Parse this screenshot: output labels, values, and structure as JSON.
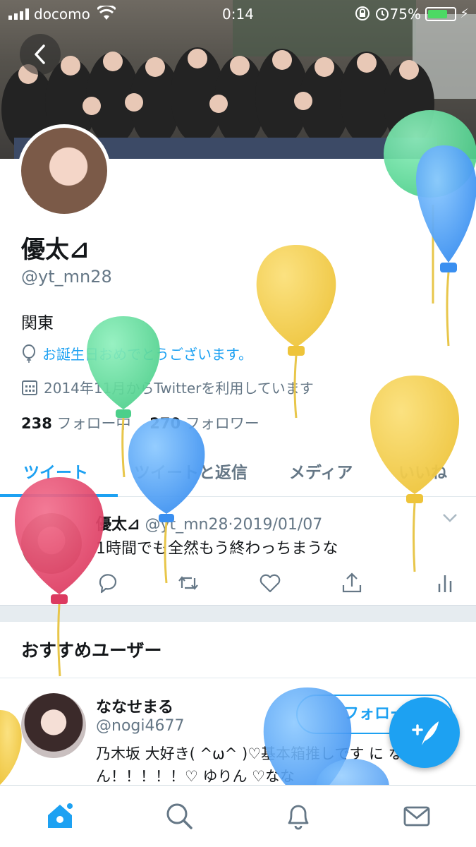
{
  "status_bar": {
    "carrier": "docomo",
    "time": "0:14",
    "battery": "75%",
    "battery_level": 0.75
  },
  "profile": {
    "name": "優太⊿",
    "handle": "@yt_mn28",
    "location": "関東",
    "birthday_text": "お誕生日おめでとうございます。",
    "joined_text": "2014年11月からTwitterを利用しています",
    "following_count": "238",
    "following_label": "フォロー中",
    "followers_count": "270",
    "followers_label": "フォロワー"
  },
  "tabs": [
    {
      "label": "ツイート",
      "active": true
    },
    {
      "label": "ツイートと返信",
      "active": false
    },
    {
      "label": "メディア",
      "active": false
    },
    {
      "label": "いいね",
      "active": false
    }
  ],
  "tweet": {
    "name": "優太⊿",
    "handle": "@yt_mn28",
    "separator": "·",
    "date": "2019/01/07",
    "text": "1時間でも全然もう終わっちまうな"
  },
  "recommended": {
    "title": "おすすめユーザー",
    "user": {
      "name": "ななせまる",
      "handle": "@nogi4677",
      "bio": "乃木坂 大好き( ^ω^ )♡基本箱推しです に なーちゃん！！！！！♡ ゆりん ♡なな",
      "follow_label": "フォロー"
    }
  },
  "colors": {
    "accent": "#1da1f2",
    "text_secondary": "#657786",
    "balloon_green": "#5fdc9a",
    "balloon_blue": "#4aa3f5",
    "balloon_yellow": "#f2cf45",
    "balloon_red": "#e6456a"
  },
  "icons": {
    "back": "chevron-left-icon",
    "birthday": "balloon-icon",
    "joined": "calendar-icon",
    "reply": "reply-icon",
    "retweet": "retweet-icon",
    "like": "heart-icon",
    "share": "share-icon",
    "analytics": "analytics-icon",
    "compose": "compose-icon",
    "nav": [
      "home-icon",
      "search-icon",
      "notifications-icon",
      "messages-icon"
    ]
  }
}
